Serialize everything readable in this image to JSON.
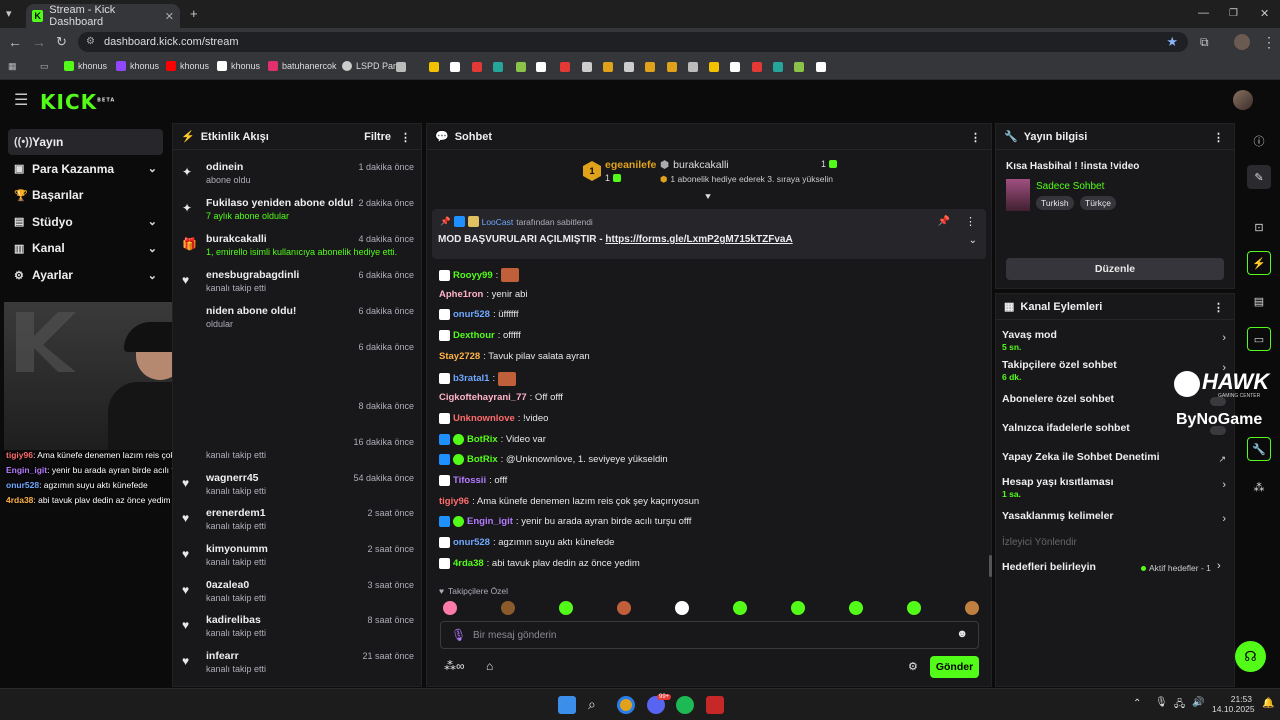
{
  "browser": {
    "tab_title": "Stream - Kick Dashboard",
    "url": "dashboard.kick.com/stream",
    "bookmarks": [
      {
        "label": "khonus",
        "color": "#53fc18"
      },
      {
        "label": "khonus",
        "color": "#9146ff"
      },
      {
        "label": "khonus",
        "color": "#ff0000"
      },
      {
        "label": "khonus",
        "color": "#ffffff"
      },
      {
        "label": "batuhanercok",
        "color": "#e1306c"
      },
      {
        "label": "LSPD Panel",
        "color": "#cccccc"
      }
    ]
  },
  "app": {
    "logo": "KICK",
    "logo_sup": "BETA"
  },
  "sidebar": {
    "items": [
      {
        "label": "Yayın",
        "icon": "broadcast-icon",
        "active": true
      },
      {
        "label": "Para Kazanma",
        "icon": "money-icon",
        "chev": true
      },
      {
        "label": "Başarılar",
        "icon": "trophy-icon"
      },
      {
        "label": "Stüdyo",
        "icon": "studio-icon",
        "chev": true
      },
      {
        "label": "Kanal",
        "icon": "channel-icon",
        "chev": true
      },
      {
        "label": "Ayarlar",
        "icon": "settings-icon",
        "chev": true
      }
    ]
  },
  "activity": {
    "title": "Etkinlik Akışı",
    "filter": "Filtre",
    "events": [
      {
        "name": "odinein",
        "sub": "abone oldu",
        "time": "1 dakika önce",
        "icon": "sparkle-icon"
      },
      {
        "name": "Fukilaso yeniden abone oldu!",
        "sub": "7 aylık abone oldular",
        "time": "2 dakika önce",
        "icon": "sparkle-icon",
        "green": true
      },
      {
        "name": "burakcakalli",
        "sub": "1, emirello isimli kullanıcıya abonelik hediye etti.",
        "time": "4 dakika önce",
        "icon": "gift-icon",
        "green": true
      },
      {
        "name": "enesbugrabagdinli",
        "sub": "kanalı takip etti",
        "time": "6 dakika önce",
        "icon": "heart-icon"
      },
      {
        "name": "niden abone oldu!",
        "sub": "oldular",
        "time": "6 dakika önce",
        "icon": "sparkle-icon"
      },
      {
        "name": "",
        "sub": "",
        "time": "6 dakika önce",
        "icon": "heart-icon"
      },
      {
        "name": "",
        "sub": "",
        "time": "8 dakika önce",
        "icon": "heart-icon"
      },
      {
        "name": "",
        "sub": "kanalı takip etti",
        "time": "16 dakika önce",
        "icon": "heart-icon"
      },
      {
        "name": "wagnerr45",
        "sub": "kanalı takip etti",
        "time": "54 dakika önce",
        "icon": "heart-icon"
      },
      {
        "name": "erenerdem1",
        "sub": "kanalı takip etti",
        "time": "2 saat önce",
        "icon": "heart-icon"
      },
      {
        "name": "kimyonumm",
        "sub": "kanalı takip etti",
        "time": "2 saat önce",
        "icon": "heart-icon"
      },
      {
        "name": "0azalea0",
        "sub": "kanalı takip etti",
        "time": "3 saat önce",
        "icon": "heart-icon"
      },
      {
        "name": "kadirelibas",
        "sub": "kanalı takip etti",
        "time": "8 saat önce",
        "icon": "heart-icon"
      },
      {
        "name": "infearr",
        "sub": "kanalı takip etti",
        "time": "21 saat önce",
        "icon": "heart-icon"
      }
    ]
  },
  "overlay_chat": [
    {
      "user": "tigiy96",
      "color": "#ff6b6b",
      "text": ": Ama künefe denemen lazım reis çok şey kaçırıyosun"
    },
    {
      "user": "Engin_igit",
      "color": "#b57bff",
      "text": ": yenir bu arada ayran birde acılı turşu offf"
    },
    {
      "user": "onur528",
      "color": "#6fa8ff",
      "text": ": agzımın suyu aktı künefede"
    },
    {
      "user": "4rda38",
      "color": "#ffb347",
      "text": ": abi tavuk plav dedin az önce yedim"
    }
  ],
  "chat": {
    "title": "Sohbet",
    "leaderboard": [
      {
        "rank": "1",
        "name": "egeanilefe",
        "count": "1"
      },
      {
        "name": "burakcakalli",
        "count": "1",
        "note": "1 abonelik hediye ederek 3. sıraya yükselin"
      }
    ],
    "pinned": {
      "by_user": "LooCast",
      "by_text": "tarafından sabitlendi",
      "text": "MOD BAŞVURULARI AÇILMIŞTIR - ",
      "link": "https://forms.gle/LxmP2gM715kTZFvaA"
    },
    "messages": [
      {
        "user": "Rooyy99",
        "color": "#53fc18",
        "text": ":",
        "badges": 1,
        "emote": true
      },
      {
        "user": "Aphe1ron",
        "color": "#ffb3c8",
        "text": ": yenir abi",
        "badges": 0
      },
      {
        "user": "onur528",
        "color": "#6fa8ff",
        "text": ": üffffff",
        "badges": 1
      },
      {
        "user": "Dexthour",
        "color": "#53fc18",
        "text": ": offfff",
        "badges": 1
      },
      {
        "user": "Stay2728",
        "color": "#ffb347",
        "text": ": Tavuk pilav salata ayran",
        "badges": 0
      },
      {
        "user": "b3ratal1",
        "color": "#6fa8ff",
        "text": ":",
        "badges": 1,
        "emote": true
      },
      {
        "user": "Cigkoftehayrani_77",
        "color": "#ffb3c8",
        "text": ": Off offf",
        "badges": 0
      },
      {
        "user": "Unknownlove",
        "color": "#ff6b6b",
        "text": ": !video",
        "badges": 1
      },
      {
        "user": "BotRix",
        "color": "#53fc18",
        "text": ": Video var",
        "badges": 2
      },
      {
        "user": "BotRix",
        "color": "#53fc18",
        "text": ": @Unknownlove, 1. seviyeye yükseldin",
        "badges": 2
      },
      {
        "user": "Tifossii",
        "color": "#b57bff",
        "text": ": offf",
        "badges": 1
      },
      {
        "user": "tigiy96",
        "color": "#ff6b6b",
        "text": ": Ama künefe denemen lazım reis çok şey kaçırıyosun",
        "badges": 0
      },
      {
        "user": "Engin_igit",
        "color": "#b57bff",
        "text": ": yenir bu arada ayran birde acılı turşu offf",
        "badges": 2
      },
      {
        "user": "onur528",
        "color": "#6fa8ff",
        "text": ": agzımın suyu aktı künefede",
        "badges": 1
      },
      {
        "user": "4rda38",
        "color": "#53fc18",
        "text": ": abi tavuk plav dedin az önce yedim",
        "badges": 1
      }
    ],
    "emote_label": "Takipçilere Özel",
    "input_placeholder": "Bir mesaj gönderin",
    "send": "Gönder"
  },
  "stream_info": {
    "title": "Yayın bilgisi",
    "stream_title": "Kısa Hasbihal ! !insta !video",
    "category": "Sadece Sohbet",
    "tags": [
      "Turkish",
      "Türkçe"
    ],
    "edit": "Düzenle"
  },
  "channel_actions": {
    "title": "Kanal Eylemleri",
    "items": [
      {
        "label": "Yavaş mod",
        "sub": "5 sn."
      },
      {
        "label": "Takipçilere özel sohbet",
        "sub": "6 dk."
      },
      {
        "label": "Abonelere özel sohbet",
        "sub": ""
      },
      {
        "label": "Yalnızca ifadelerle sohbet",
        "sub": ""
      },
      {
        "label": "Yapay Zeka ile Sohbet Denetimi",
        "sub": ""
      },
      {
        "label": "Hesap yaşı kısıtlaması",
        "sub": "1 sa."
      },
      {
        "label": "Yasaklanmış kelimeler",
        "sub": ""
      }
    ],
    "disabled": "İzleyici Yönlendir",
    "goals": "Hedefleri belirleyin",
    "goals_status": "Aktif hedefler - 1"
  },
  "watermark": {
    "line1": "HAWK",
    "line2": "GAMING CENTER",
    "line3": "ByNoGame"
  },
  "taskbar": {
    "time": "21:53",
    "date": "14.10.2025",
    "badge": "99+"
  }
}
